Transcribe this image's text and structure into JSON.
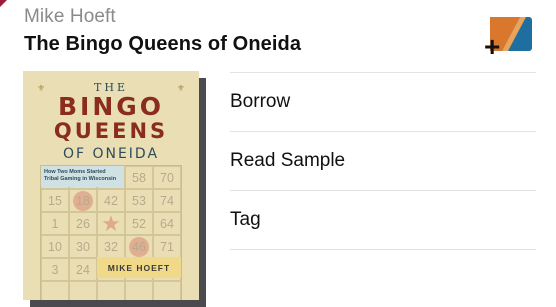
{
  "book": {
    "author": "Mike Hoeft",
    "title": "The Bingo Queens of Oneida"
  },
  "cover": {
    "the": "THE",
    "bingo": "BINGO",
    "queens": "QUEENS",
    "of_oneida": "OF ONEIDA",
    "subtitle": "How Two Moms Started Tribal Gaming in Wisconsin",
    "author": "MIKE HOEFT",
    "grid": [
      [
        "",
        "",
        "",
        "58",
        "70"
      ],
      [
        "15",
        "18",
        "42",
        "53",
        "74"
      ],
      [
        "1",
        "26",
        "",
        "52",
        "64"
      ],
      [
        "10",
        "30",
        "32",
        "46",
        "71"
      ],
      [
        "3",
        "24",
        "",
        "",
        ""
      ]
    ]
  },
  "actions": {
    "borrow": "Borrow",
    "read_sample": "Read Sample",
    "tag": "Tag"
  },
  "icons": {
    "add_to_shelf": "add-to-shelf-icon"
  },
  "colors": {
    "accent_orange": "#d9782d",
    "accent_blue": "#1f6ea0",
    "title_red": "#8a2c20"
  }
}
